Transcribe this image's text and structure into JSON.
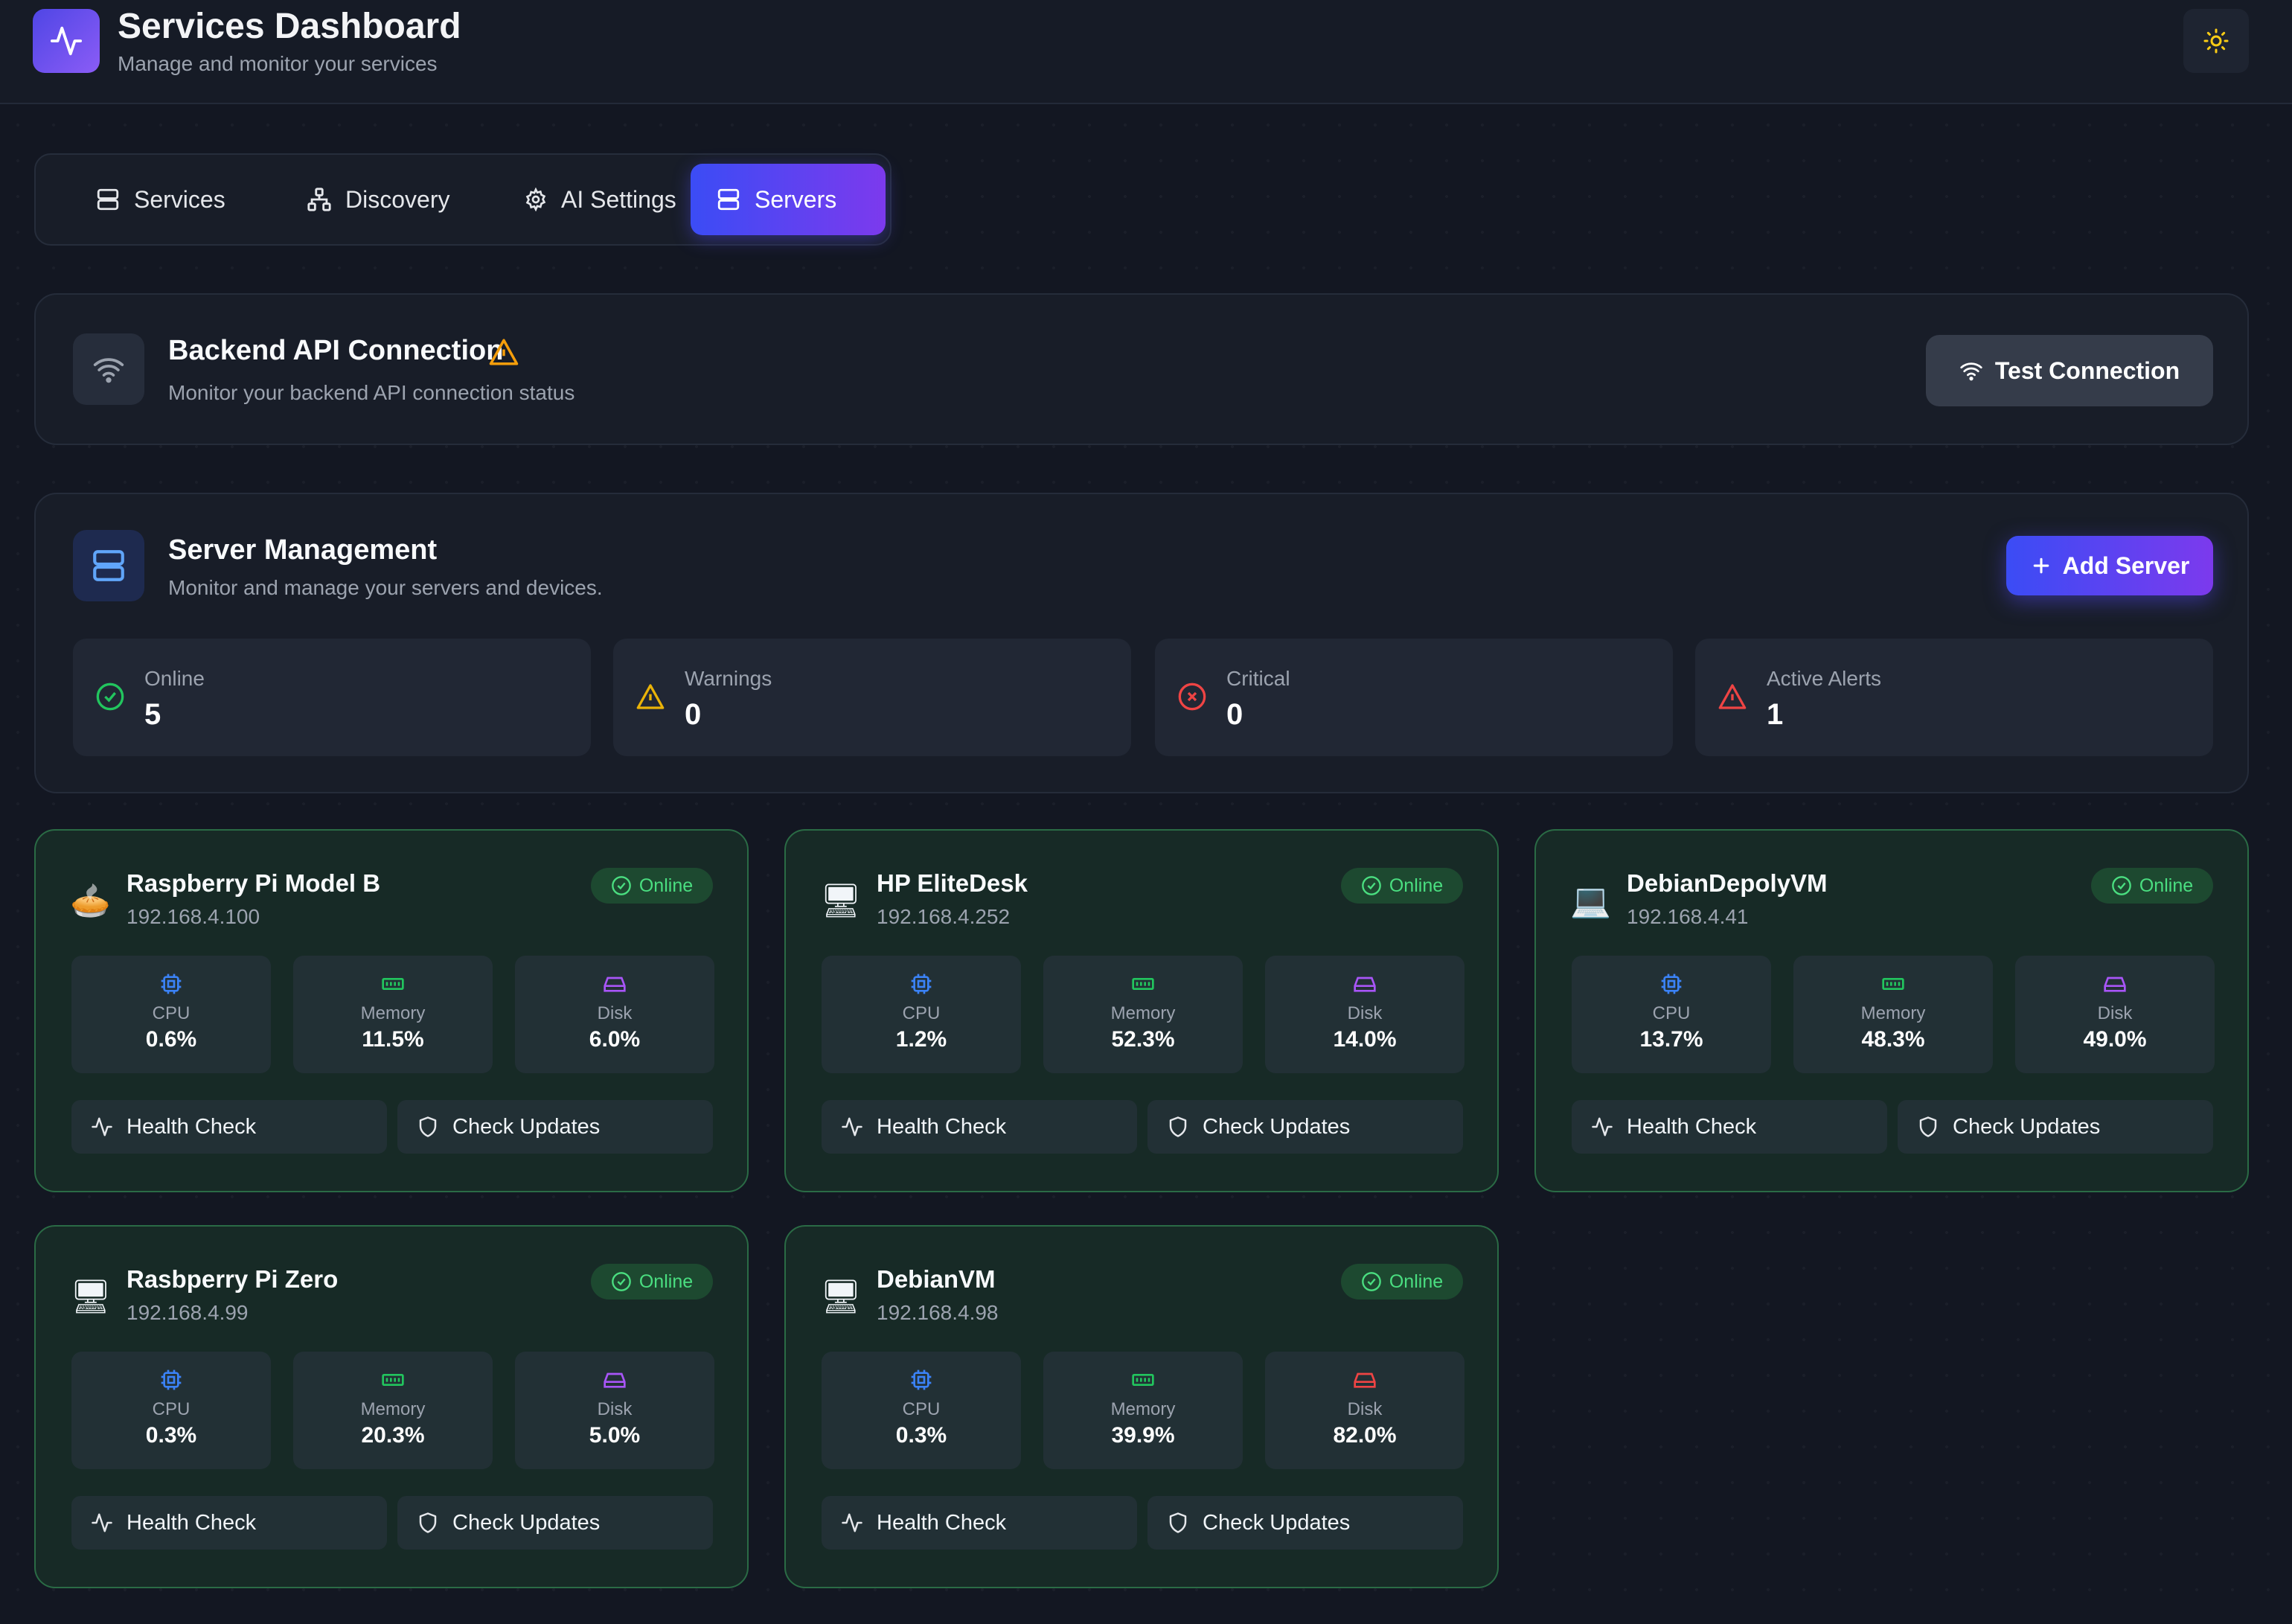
{
  "header": {
    "title": "Services Dashboard",
    "subtitle": "Manage and monitor your services"
  },
  "tabs": [
    {
      "label": "Services",
      "icon": "server-icon",
      "active": false
    },
    {
      "label": "Discovery",
      "icon": "network-icon",
      "active": false
    },
    {
      "label": "AI Settings",
      "icon": "gear-icon",
      "active": false
    },
    {
      "label": "Servers",
      "icon": "server-icon",
      "active": true
    }
  ],
  "api": {
    "title": "Backend API Connection",
    "subtitle": "Monitor your backend API connection status",
    "button": "Test Connection",
    "status_icon": "warning-icon"
  },
  "management": {
    "title": "Server Management",
    "subtitle": "Monitor and manage your servers and devices.",
    "add_button": "Add Server",
    "stats": [
      {
        "label": "Online",
        "value": "5",
        "icon": "check-circle-icon",
        "color": "#22c55e"
      },
      {
        "label": "Warnings",
        "value": "0",
        "icon": "warning-icon",
        "color": "#eab308"
      },
      {
        "label": "Critical",
        "value": "0",
        "icon": "x-circle-icon",
        "color": "#ef4444"
      },
      {
        "label": "Active Alerts",
        "value": "1",
        "icon": "alert-triangle-icon",
        "color": "#ef4444"
      }
    ]
  },
  "servers": [
    {
      "name": "Raspberry Pi Model B",
      "ip": "192.168.4.100",
      "status": "Online",
      "device_icon": "pie-icon",
      "cpu": "0.6%",
      "memory": "11.5%",
      "disk": "6.0%",
      "disk_color": "#a855f7"
    },
    {
      "name": "HP EliteDesk",
      "ip": "192.168.4.252",
      "status": "Online",
      "device_icon": "desktop-icon",
      "cpu": "1.2%",
      "memory": "52.3%",
      "disk": "14.0%",
      "disk_color": "#a855f7"
    },
    {
      "name": "DebianDepolyVM",
      "ip": "192.168.4.41",
      "status": "Online",
      "device_icon": "laptop-icon",
      "cpu": "13.7%",
      "memory": "48.3%",
      "disk": "49.0%",
      "disk_color": "#a855f7"
    },
    {
      "name": "Rasbperry Pi Zero",
      "ip": "192.168.4.99",
      "status": "Online",
      "device_icon": "desktop-icon",
      "cpu": "0.3%",
      "memory": "20.3%",
      "disk": "5.0%",
      "disk_color": "#a855f7"
    },
    {
      "name": "DebianVM",
      "ip": "192.168.4.98",
      "status": "Online",
      "device_icon": "desktop-icon",
      "cpu": "0.3%",
      "memory": "39.9%",
      "disk": "82.0%",
      "disk_color": "#ef4444"
    }
  ],
  "labels": {
    "cpu": "CPU",
    "memory": "Memory",
    "disk": "Disk",
    "health": "Health Check",
    "updates": "Check Updates"
  }
}
